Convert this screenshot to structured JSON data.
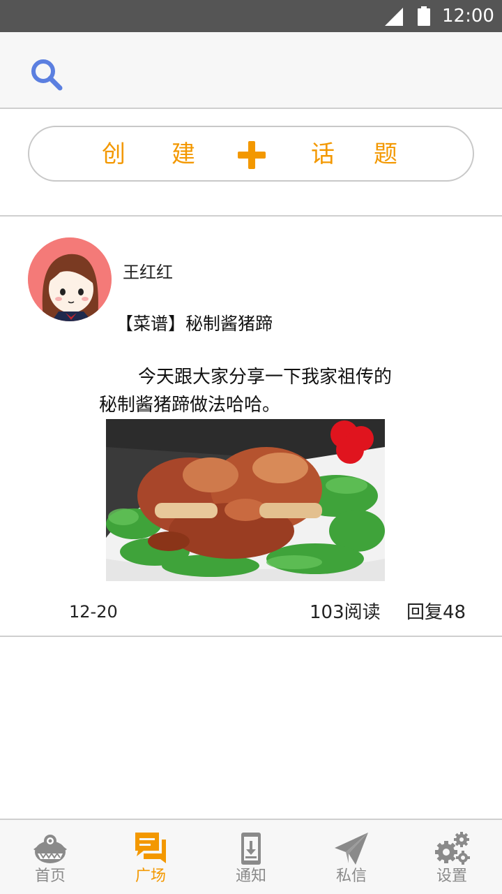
{
  "status_bar": {
    "time": "12:00",
    "signal_icon": "cellular-signal-icon",
    "battery_icon": "battery-icon"
  },
  "header": {
    "search_icon": "search-icon"
  },
  "create_topic": {
    "chars": [
      "创",
      "建",
      "话",
      "题"
    ],
    "plus_icon": "plus-icon",
    "color": "#f39800"
  },
  "post": {
    "author": "王红红",
    "title": "【菜谱】秘制酱猪蹄",
    "body": "今天跟大家分享一下我家祖传的秘制酱猪蹄做法哈哈。",
    "image_alt": "braised-pork-trotters-image",
    "date": "12-20",
    "reads": "103阅读",
    "replies": "回复48"
  },
  "nav": {
    "active_color": "#f39800",
    "inactive_color": "#8a8a8a",
    "items": [
      {
        "label": "首页",
        "icon": "monster-home-icon",
        "active": false
      },
      {
        "label": "广场",
        "icon": "chat-bubbles-icon",
        "active": true
      },
      {
        "label": "通知",
        "icon": "phone-download-icon",
        "active": false
      },
      {
        "label": "私信",
        "icon": "paper-plane-icon",
        "active": false
      },
      {
        "label": "设置",
        "icon": "gears-icon",
        "active": false
      }
    ]
  }
}
